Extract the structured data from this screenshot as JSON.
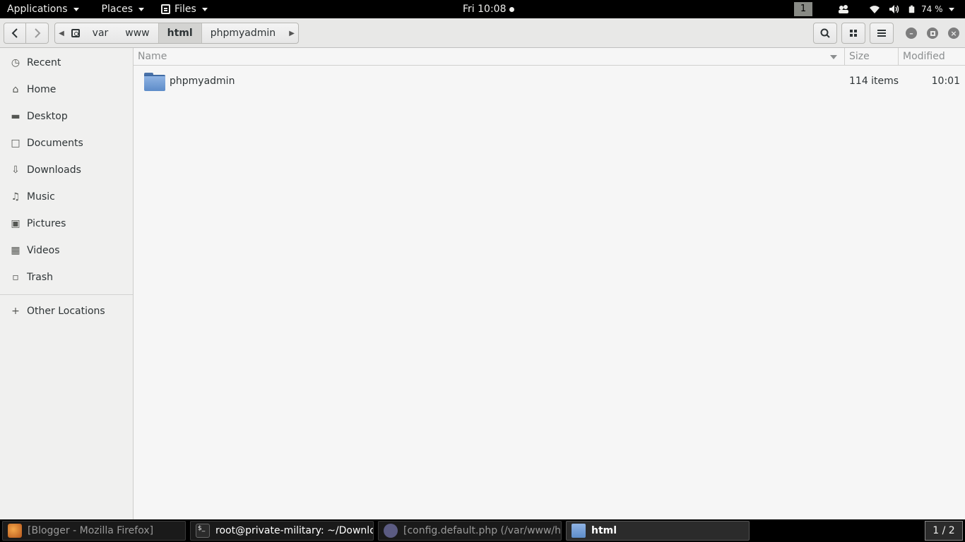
{
  "topbar": {
    "applications": "Applications",
    "places": "Places",
    "files": "Files",
    "clock": "Fri 10:08",
    "workspace": "1",
    "battery_percent": "74 %"
  },
  "pathbar": {
    "crumbs": [
      "var",
      "www",
      "html",
      "phpmyadmin"
    ],
    "active_index": 2
  },
  "sidebar": {
    "items": [
      {
        "label": "Recent",
        "icon": "clock-icon"
      },
      {
        "label": "Home",
        "icon": "home-icon"
      },
      {
        "label": "Desktop",
        "icon": "desktop-icon"
      },
      {
        "label": "Documents",
        "icon": "document-icon"
      },
      {
        "label": "Downloads",
        "icon": "download-icon"
      },
      {
        "label": "Music",
        "icon": "music-icon"
      },
      {
        "label": "Pictures",
        "icon": "pictures-icon"
      },
      {
        "label": "Videos",
        "icon": "video-icon"
      },
      {
        "label": "Trash",
        "icon": "trash-icon"
      }
    ],
    "other_locations": "Other Locations"
  },
  "list": {
    "columns": {
      "name": "Name",
      "size": "Size",
      "modified": "Modified"
    },
    "rows": [
      {
        "name": "phpmyadmin",
        "size": "114 items",
        "modified": "10:01",
        "icon": "folder-icon"
      }
    ]
  },
  "taskbar": {
    "tasks": [
      {
        "label": "[Blogger - Mozilla Firefox]",
        "icon": "firefox-icon",
        "active": false
      },
      {
        "label": "root@private-military: ~/Downloa...",
        "icon": "terminal-icon",
        "active": false
      },
      {
        "label": "[config.default.php (/var/www/ht...",
        "icon": "text-editor-icon",
        "active": false
      },
      {
        "label": "html",
        "icon": "folder-icon",
        "active": true
      }
    ],
    "pager": "1 / 2"
  },
  "colors": {
    "panel": "#000000",
    "folder": "#6f9bd6",
    "background": "#f6f6f6",
    "sidebar": "#f0f0ef"
  }
}
